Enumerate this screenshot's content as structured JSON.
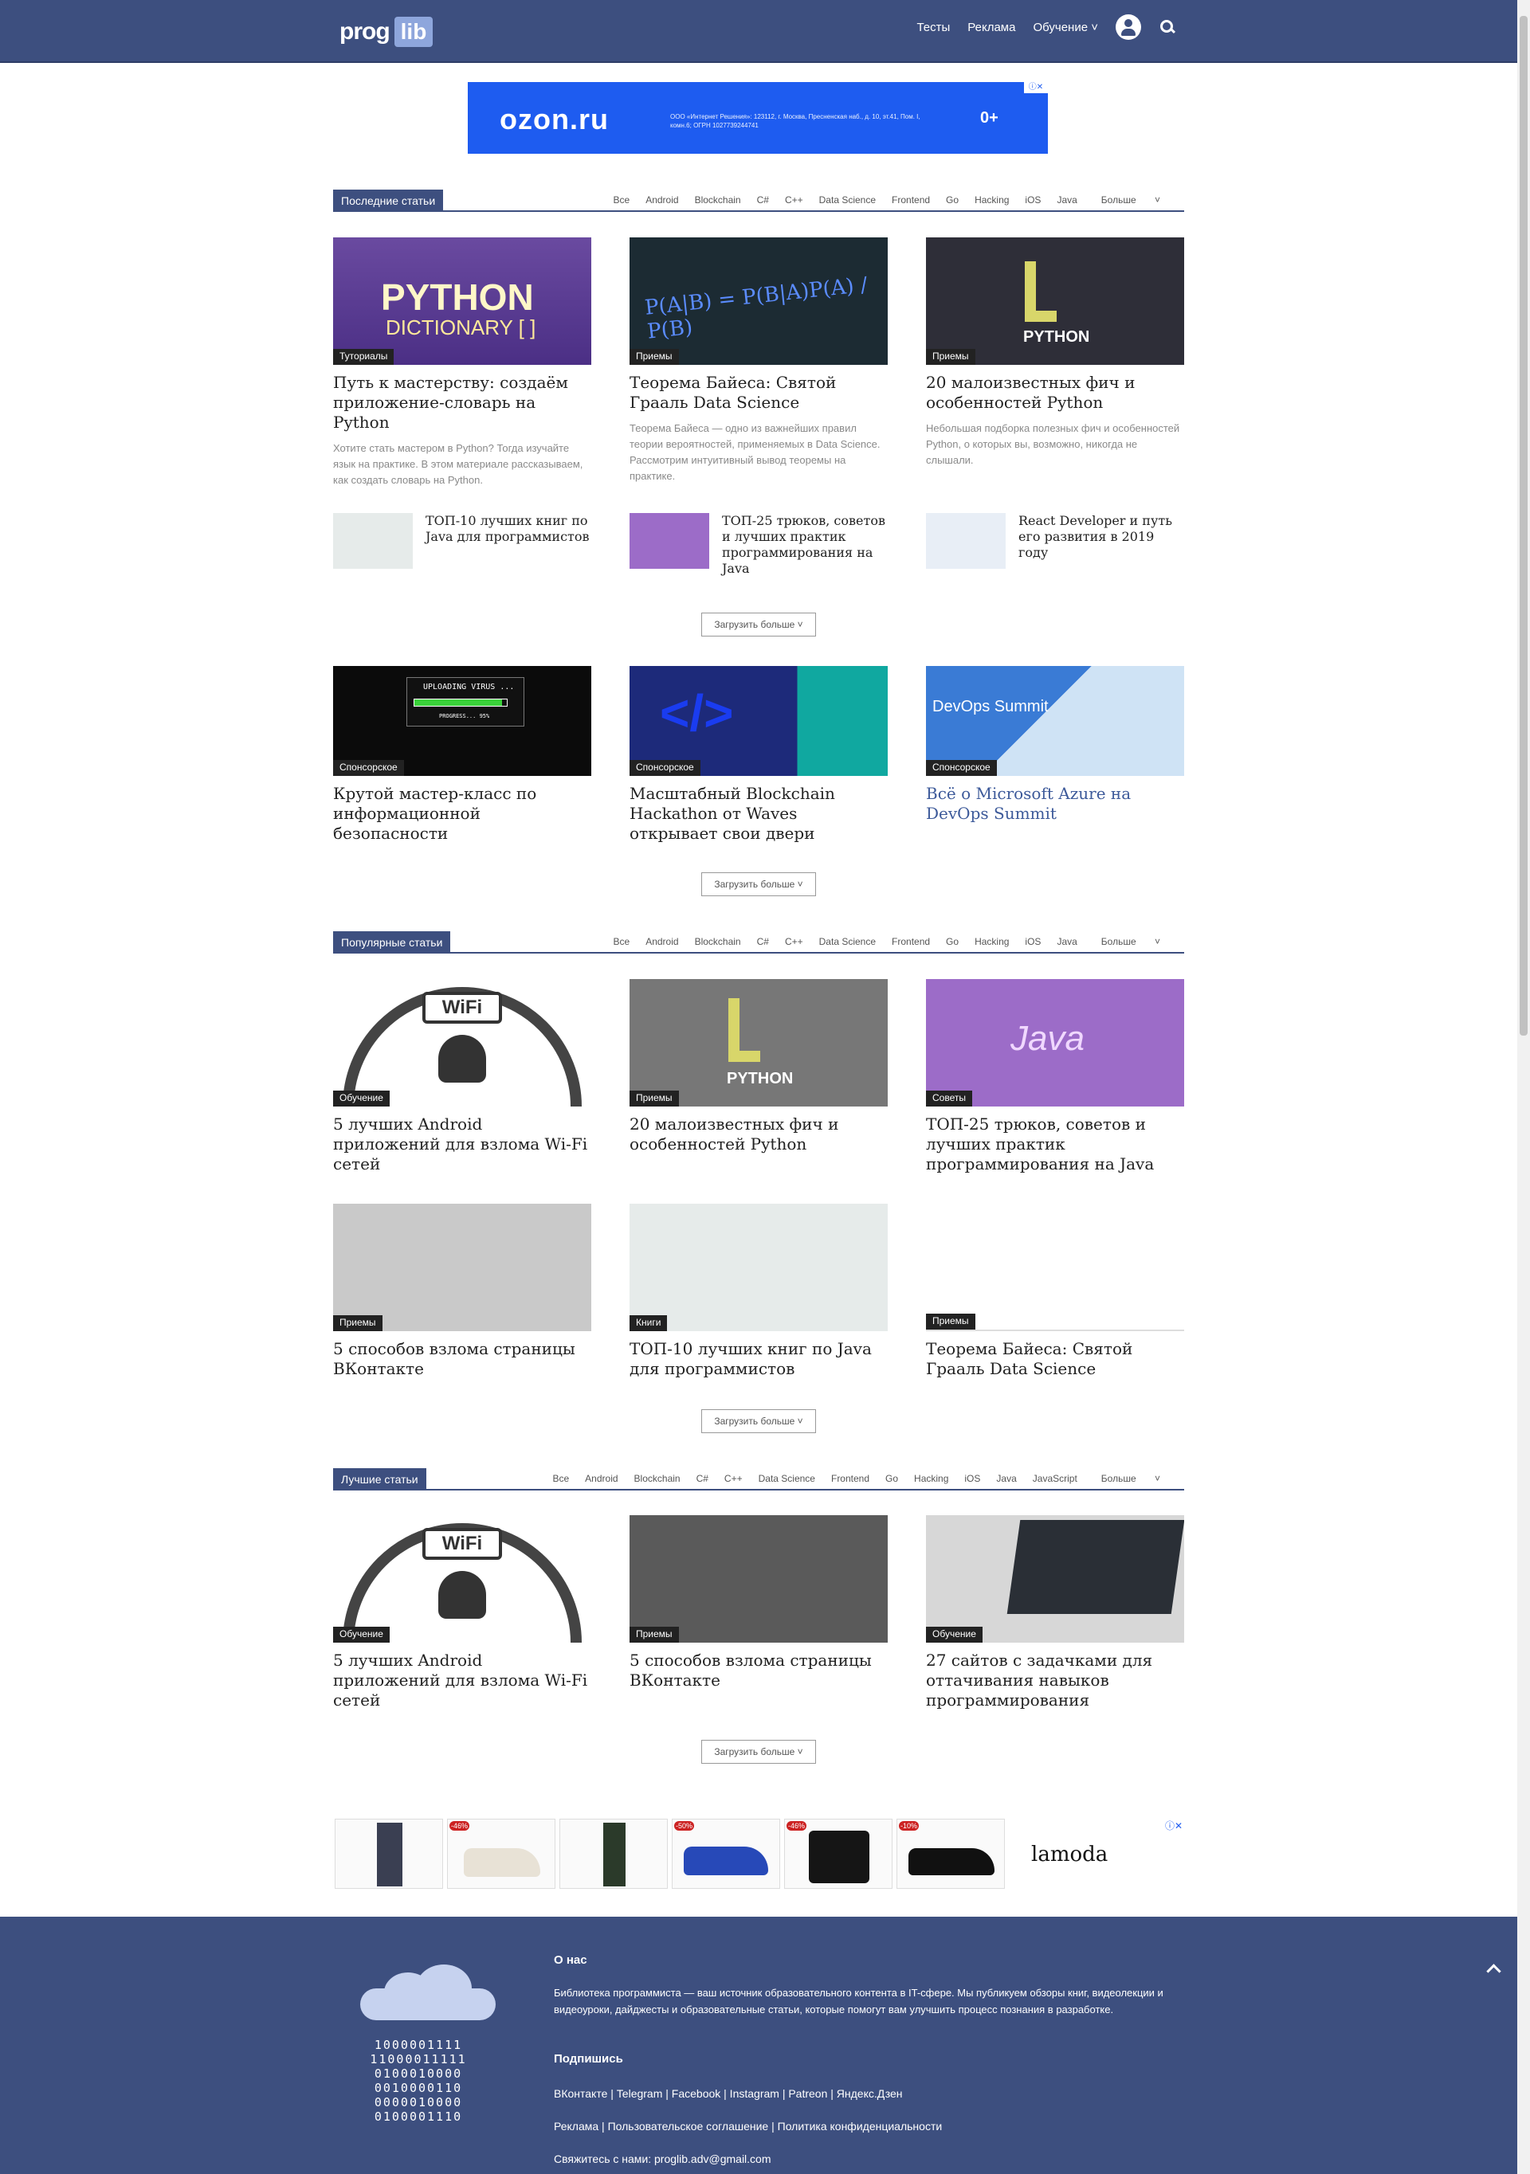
{
  "header": {
    "logo_prog": "prog",
    "logo_lib": "lib",
    "nav": [
      "Тесты",
      "Реклама",
      "Обучение"
    ]
  },
  "top_ad": {
    "brand": "ozon.ru",
    "legal": "ООО «Интернет Решения»: 123112, г. Москва, Пресненская наб., д. 10, эт.41, Пом. I, комн.6; ОГРН 1027739244741",
    "age": "0+"
  },
  "tabs_std": [
    "Все",
    "Android",
    "Blockchain",
    "C#",
    "C++",
    "Data Science",
    "Frontend",
    "Go",
    "Hacking",
    "iOS",
    "Java",
    "Больше"
  ],
  "tabs_best": [
    "Все",
    "Android",
    "Blockchain",
    "C#",
    "C++",
    "Data Science",
    "Frontend",
    "Go",
    "Hacking",
    "iOS",
    "Java",
    "JavaScript",
    "Больше"
  ],
  "latest": {
    "title": "Последние статьи",
    "cards": [
      {
        "cat": "Туториалы",
        "title": "Путь к мастерству: создаём приложение-словарь на Python",
        "desc": "Хотите стать мастером в Python? Тогда изучайте язык на практике. В этом материале рассказываем, как создать словарь на Python.",
        "img_text1": "PYTHON",
        "img_text2": "DICTIONARY [ ]"
      },
      {
        "cat": "Приемы",
        "title": "Теорема Байеса: Святой Грааль Data Science",
        "desc": "Теорема Байеса — одно из важнейших правил теории вероятностей, применяемых в Data Science. Рассмотрим интуитивный вывод теоремы на практике.",
        "img_text1": "P(A|B) = P(B|A)P(A) / P(B)"
      },
      {
        "cat": "Приемы",
        "title": "20 малоизвестных фич и особенностей Python",
        "desc": "Небольшая подборка полезных фич и особенностей Python, о которых вы, возможно, никогда не слышали.",
        "img_text1": "PYTHON"
      }
    ],
    "minis": [
      "ТОП-10 лучших книг по Java для программистов",
      "ТОП-25 трюков, советов и лучших практик программирования на Java",
      "React Developer и путь его развития в 2019 году"
    ],
    "more": "Загрузить больше"
  },
  "sponsored": {
    "cards": [
      {
        "cat": "Спонсорское",
        "title": "Крутой мастер-класс по информационной безопасности",
        "img_text1": "UPLOADING VIRUS ...",
        "img_text2": "PROGRESS... 95%"
      },
      {
        "cat": "Спонсорское",
        "title": "Масштабный Blockchain Hackathon от Waves открывает свои двери",
        "img_text1": "</>"
      },
      {
        "cat": "Спонсорское",
        "title": "Всё о Microsoft Azure на DevOps Summit",
        "img_text1": "DevOps Summit"
      }
    ],
    "more": "Загрузить больше"
  },
  "popular": {
    "title": "Популярные статьи",
    "cards": [
      {
        "cat": "Обучение",
        "title": "5 лучших Android приложений для взлома Wi-Fi сетей",
        "img_text1": "WiFi"
      },
      {
        "cat": "Приемы",
        "title": "20 малоизвестных фич и особенностей Python",
        "img_text1": "PYTHON"
      },
      {
        "cat": "Советы",
        "title": "ТОП-25 трюков, советов и лучших практик программирования на Java",
        "img_text1": "Java"
      },
      {
        "cat": "Приемы",
        "title": "5 способов взлома страницы ВКонтакте"
      },
      {
        "cat": "Книги",
        "title": "ТОП-10 лучших книг по Java для программистов"
      },
      {
        "cat": "Приемы",
        "title": "Теорема Байеса: Святой Грааль Data Science"
      }
    ],
    "more": "Загрузить больше"
  },
  "best": {
    "title": "Лучшие статьи",
    "cards": [
      {
        "cat": "Обучение",
        "title": "5 лучших Android приложений для взлома Wi-Fi сетей",
        "img_text1": "WiFi"
      },
      {
        "cat": "Приемы",
        "title": "5 способов взлома страницы ВКонтакте"
      },
      {
        "cat": "Обучение",
        "title": "27 сайтов с задачками для оттачивания навыков программирования"
      }
    ],
    "more": "Загрузить больше"
  },
  "bottom_ad": {
    "badges": [
      "-46%",
      "-50%",
      "-46%",
      "-10%"
    ],
    "brand": "lamoda"
  },
  "footer": {
    "about_title": "О нас",
    "about_text": "Библиотека программиста — ваш источник образовательного контента в IT-сфере. Мы публикуем обзоры книг, видеолекции и видеоуроки, дайджесты и образовательные статьи, которые помогут вам улучшить процесс познания в разработке.",
    "subscribe_title": "Подпишись",
    "social": "ВКонтакте | Telegram | Facebook | Instagram | Patreon | Яндекс.Дзен",
    "legal": "Реклама | Пользовательское соглашение | Политика конфиденциальности",
    "contact_label": "Свяжитесь с нами:",
    "contact_email": "proglib.adv@gmail.com",
    "binary": [
      "1000001111",
      "11000011111",
      "0100010000",
      "0010000110",
      "0000010000",
      "0100001110"
    ]
  },
  "colors": {
    "brand": "#3d4f7f",
    "accent": "#8ea6dc",
    "ozon": "#1e5cf0"
  }
}
